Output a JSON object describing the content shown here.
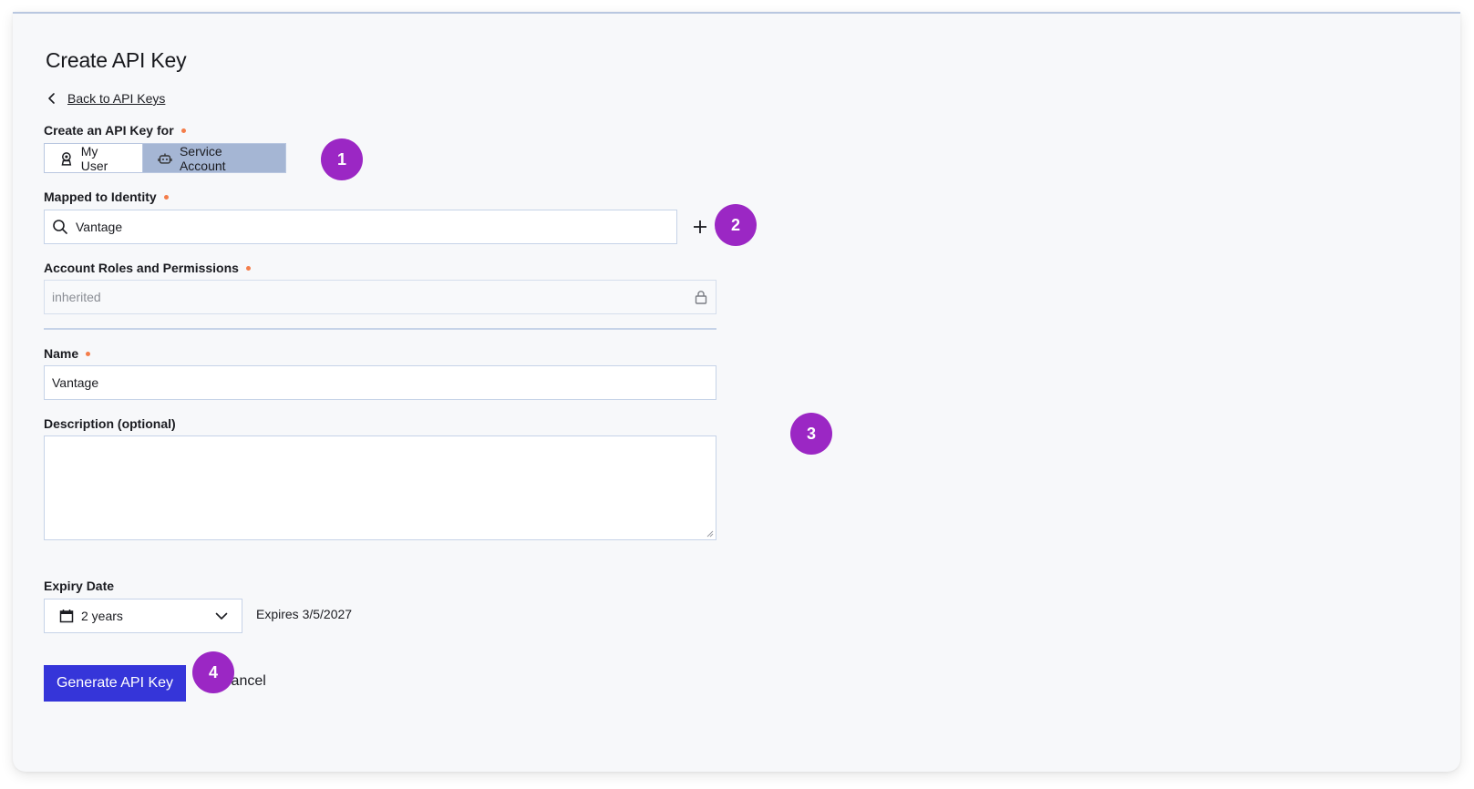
{
  "page": {
    "title": "Create API Key",
    "back_link": "Back to API Keys"
  },
  "create_for": {
    "label": "Create an API Key for",
    "required": true,
    "options": [
      {
        "label": "My User",
        "icon": "user-badge-icon",
        "selected": false
      },
      {
        "label": "Service Account",
        "icon": "robot-icon",
        "selected": true
      }
    ]
  },
  "identity": {
    "label": "Mapped to Identity",
    "required": true,
    "value": "Vantage",
    "icon": "search-icon",
    "add_icon": "plus-icon"
  },
  "roles": {
    "label": "Account Roles and Permissions",
    "required": true,
    "value": "inherited",
    "icon": "lock-icon",
    "disabled": true
  },
  "name": {
    "label": "Name",
    "required": true,
    "value": "Vantage"
  },
  "description": {
    "label": "Description (optional)",
    "value": ""
  },
  "expiry": {
    "label": "Expiry Date",
    "value": "2 years",
    "icon": "calendar-icon",
    "expires_text": "Expires 3/5/2027"
  },
  "actions": {
    "generate_label": "Generate API Key",
    "cancel_label": "Cancel"
  },
  "annotations": [
    "1",
    "2",
    "3",
    "4"
  ],
  "colors": {
    "primary_button": "#3535d9",
    "badge": "#9b27c4",
    "required_dot": "#f47d4a",
    "selected_segment": "#a5b6d4"
  }
}
